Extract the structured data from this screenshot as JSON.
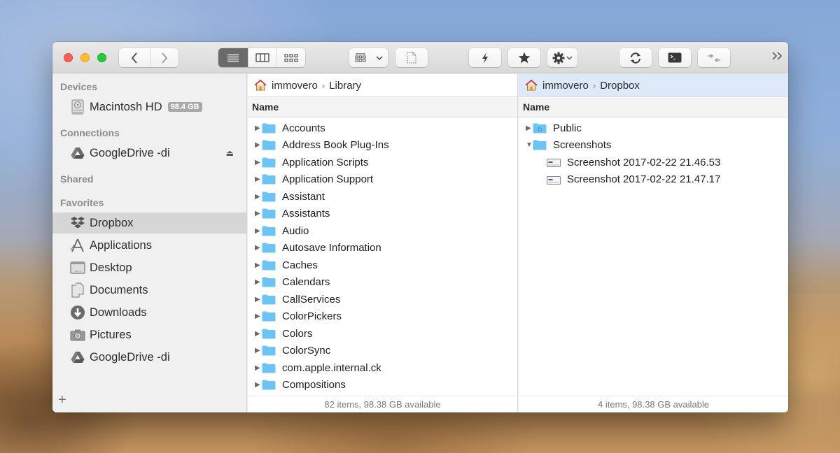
{
  "toolbar": {
    "view_modes": [
      "list",
      "columns",
      "icons"
    ],
    "active_view": "list",
    "buttons": [
      "back",
      "forward",
      "view-options",
      "new-file",
      "quick-action",
      "favorite",
      "settings",
      "sync",
      "terminal",
      "compare",
      "more"
    ]
  },
  "sidebar": {
    "sections": {
      "devices": "Devices",
      "connections": "Connections",
      "shared": "Shared",
      "favorites": "Favorites"
    },
    "devices": [
      {
        "label": "Macintosh HD",
        "badge": "98.4 GB",
        "icon": "hard-drive-icon"
      }
    ],
    "connections": [
      {
        "label": "GoogleDrive -di",
        "icon": "google-drive-icon"
      }
    ],
    "favorites": [
      {
        "label": "Dropbox",
        "icon": "dropbox-icon",
        "selected": true
      },
      {
        "label": "Applications",
        "icon": "applications-icon"
      },
      {
        "label": "Desktop",
        "icon": "desktop-icon"
      },
      {
        "label": "Documents",
        "icon": "documents-icon"
      },
      {
        "label": "Downloads",
        "icon": "downloads-icon"
      },
      {
        "label": "Pictures",
        "icon": "pictures-icon"
      },
      {
        "label": "GoogleDrive -di",
        "icon": "google-drive-icon"
      }
    ],
    "add_label": "+"
  },
  "left_pane": {
    "path": [
      "immovero",
      "Library"
    ],
    "column_header": "Name",
    "rows": [
      "Accounts",
      "Address Book Plug-Ins",
      "Application Scripts",
      "Application Support",
      "Assistant",
      "Assistants",
      "Audio",
      "Autosave Information",
      "Caches",
      "Calendars",
      "CallServices",
      "ColorPickers",
      "Colors",
      "ColorSync",
      "com.apple.internal.ck",
      "Compositions"
    ],
    "status": "82 items, 98.38 GB available"
  },
  "right_pane": {
    "path": [
      "immovero",
      "Dropbox"
    ],
    "column_header": "Name",
    "rows": [
      {
        "name": "Public",
        "type": "public-folder",
        "expanded": false,
        "level": 0
      },
      {
        "name": "Screenshots",
        "type": "folder",
        "expanded": true,
        "level": 0
      },
      {
        "name": "Screenshot 2017-02-22 21.46.53",
        "type": "file",
        "level": 1
      },
      {
        "name": "Screenshot 2017-02-22 21.47.17",
        "type": "file",
        "level": 1
      }
    ],
    "status": "4 items, 98.38 GB available"
  },
  "colors": {
    "folder": "#6cc4f5",
    "selected_sidebar": "#d6d6d6",
    "active_pane_path": "#dde8f8",
    "close": "#fe5f57",
    "minimize": "#febc2e",
    "maximize": "#28c840"
  }
}
